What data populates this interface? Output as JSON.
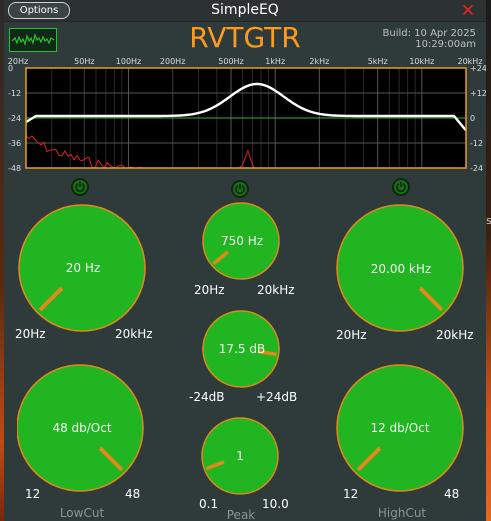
{
  "window": {
    "options_label": "Options",
    "title": "SimpleEQ",
    "close_glyph": "✕",
    "close_icon": "close-icon"
  },
  "header": {
    "brand": "RVTGTR",
    "build_line1": "Build: 10 Apr 2025",
    "build_line2": "10:29:00am",
    "scope_icon": "waveform-icon"
  },
  "desk_right_glyph": "s",
  "graph": {
    "freq_labels": [
      "20Hz",
      "50Hz",
      "100Hz",
      "200Hz",
      "500Hz",
      "1kHz",
      "2kHz",
      "5kHz",
      "10kHz",
      "20kHz"
    ],
    "db_left": [
      "0",
      "-12",
      "-24",
      "-36",
      "-48"
    ],
    "db_right": [
      "+24",
      "+12",
      "0",
      "-12",
      "-24"
    ],
    "colors": {
      "border": "#e8a020",
      "grid": "#555555",
      "response": "#ffffff",
      "spectrum": "#e02020",
      "zero_line": "#30b030"
    }
  },
  "colors": {
    "knob_fill": "#22b522",
    "knob_border": "#e08a1c",
    "pointer": "#e08a1c",
    "background": "#2f3b3b"
  },
  "bands": {
    "lowcut": {
      "label": "LowCut",
      "freq": {
        "value": "20 Hz",
        "min": "20Hz",
        "max": "20kHz",
        "level": 0.0
      },
      "slope": {
        "value": "48 db/Oct",
        "min": "12",
        "max": "48",
        "level": 1.0
      }
    },
    "peak": {
      "label": "Peak",
      "freq": {
        "value": "750 Hz",
        "min": "20Hz",
        "max": "20kHz",
        "level": 0.02
      },
      "gain": {
        "value": "17.5 dB",
        "min": "-24dB",
        "max": "+24dB",
        "level": 0.865
      },
      "quality": {
        "value": "1",
        "min": "0.1",
        "max": "10.0",
        "level": 0.09
      }
    },
    "highcut": {
      "label": "HighCut",
      "freq": {
        "value": "20.00 kHz",
        "min": "20Hz",
        "max": "20kHz",
        "level": 1.0
      },
      "slope": {
        "value": "12 db/Oct",
        "min": "12",
        "max": "48",
        "level": 0.0
      }
    }
  }
}
